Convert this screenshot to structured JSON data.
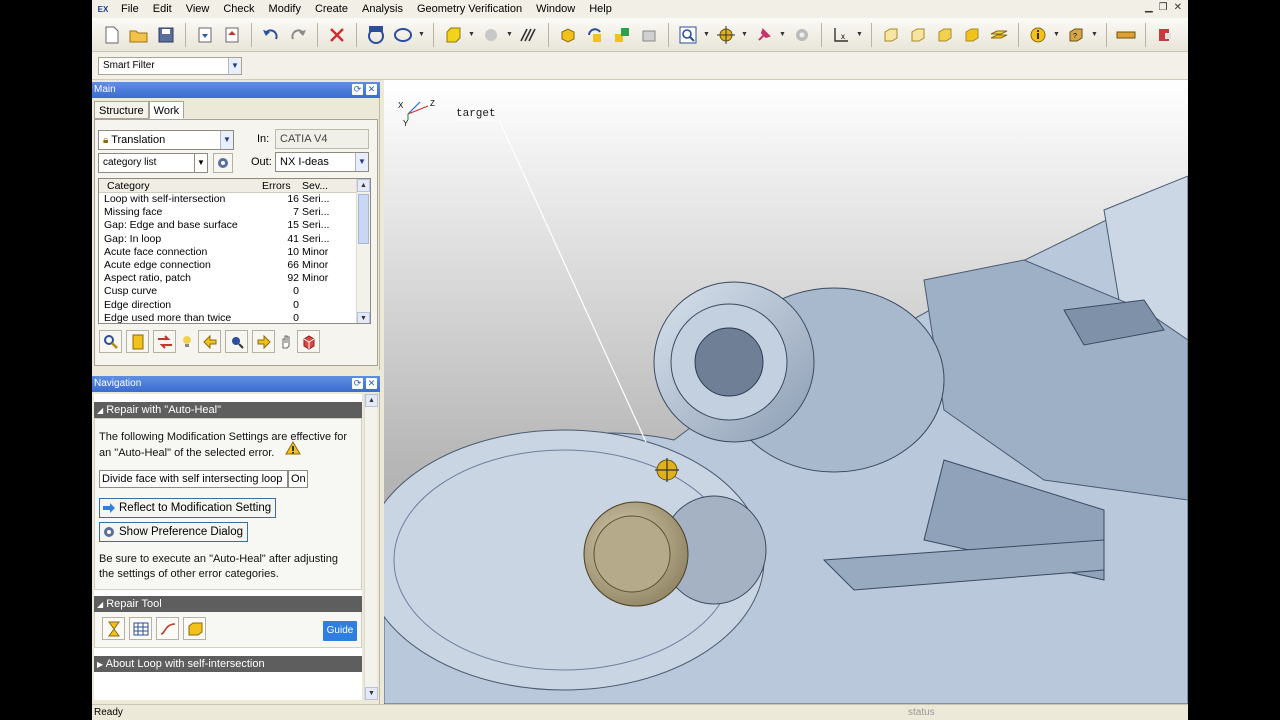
{
  "menu": [
    "File",
    "Edit",
    "View",
    "Check",
    "Modify",
    "Create",
    "Analysis",
    "Geometry Verification",
    "Window",
    "Help"
  ],
  "app_logo": "EX",
  "filter": {
    "value": "Smart Filter"
  },
  "main_panel": {
    "title": "Main",
    "tabs": [
      "Structure",
      "Work"
    ],
    "mode": "Translation",
    "list_mode": "category list",
    "in_label": "In:",
    "in_value": "CATIA V4",
    "out_label": "Out:",
    "out_value": "NX I-deas",
    "columns": {
      "category": "Category",
      "errors": "Errors",
      "severity": "Sev..."
    },
    "rows": [
      {
        "category": "Loop with self-intersection",
        "errors": "16",
        "severity": "Seri..."
      },
      {
        "category": "Missing face",
        "errors": "7",
        "severity": "Seri..."
      },
      {
        "category": "Gap: Edge and base surface",
        "errors": "15",
        "severity": "Seri..."
      },
      {
        "category": "Gap: In loop",
        "errors": "41",
        "severity": "Seri..."
      },
      {
        "category": "Acute face connection",
        "errors": "10",
        "severity": "Minor"
      },
      {
        "category": "Acute edge connection",
        "errors": "66",
        "severity": "Minor"
      },
      {
        "category": "Aspect ratio, patch",
        "errors": "92",
        "severity": "Minor"
      },
      {
        "category": "Cusp curve",
        "errors": "0",
        "severity": ""
      },
      {
        "category": "Edge direction",
        "errors": "0",
        "severity": ""
      },
      {
        "category": "Edge used more than twice",
        "errors": "0",
        "severity": ""
      }
    ]
  },
  "navigation": {
    "title": "Navigation",
    "repair_header": "Repair with \"Auto-Heal\"",
    "desc1": "The following Modification Settings are effective for",
    "desc2": "an \"Auto-Heal\" of the selected error.",
    "setting_name": "Divide face with self intersecting loop",
    "setting_value": "On",
    "reflect_button": "Reflect to Modification Setting",
    "pref_button": "Show Preference Dialog",
    "note1": "Be sure to execute an \"Auto-Heal\" after adjusting",
    "note2": "the settings of other error categories.",
    "repair_tool_header": "Repair Tool",
    "guide_button": "Guide",
    "about_header": "About Loop with self-intersection"
  },
  "viewport": {
    "annotation": "target",
    "axes": {
      "x": "X",
      "y": "Y",
      "z": "Z"
    }
  },
  "status": {
    "left": "Ready",
    "center": "status"
  }
}
